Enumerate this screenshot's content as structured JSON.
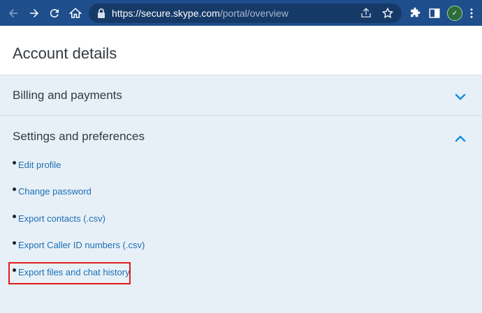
{
  "browser": {
    "url_host": "https://secure.skype.com",
    "url_path": "/portal/overview",
    "icons": [
      "back-icon",
      "forward-icon",
      "reload-icon",
      "home-icon",
      "lock-icon",
      "share-icon",
      "star-icon",
      "extensions-icon",
      "sidebar-icon",
      "profile-avatar",
      "menu-icon"
    ]
  },
  "page": {
    "title": "Account details"
  },
  "sections": {
    "billing": {
      "label": "Billing and payments",
      "state": "collapsed"
    },
    "settings": {
      "label": "Settings and preferences",
      "state": "expanded",
      "links": [
        "Edit profile",
        "Change password",
        "Export contacts (.csv)",
        "Export Caller ID numbers (.csv)",
        "Export files and chat history"
      ]
    }
  },
  "colors": {
    "toolbar": "#1f4e8c",
    "link": "#1a6fb5",
    "chevron": "#1a8fd8",
    "highlight": "#e01b1b",
    "section_bg": "#e8f0f7"
  }
}
